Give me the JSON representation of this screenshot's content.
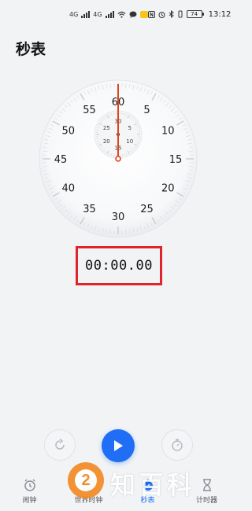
{
  "status_bar": {
    "carrier_left": "4G",
    "carrier_right": "4G",
    "battery": "74",
    "time": "13:12"
  },
  "page": {
    "title": "秒表"
  },
  "dial": {
    "major_labels": [
      "60",
      "5",
      "10",
      "15",
      "20",
      "25",
      "30",
      "35",
      "40",
      "45",
      "50",
      "55"
    ],
    "minor_labels": [
      "30",
      "5",
      "10",
      "15",
      "20",
      "25"
    ],
    "hand_color": "#e0461c",
    "hand_angle_deg": 0
  },
  "timer": {
    "value": "00:00.00",
    "highlight_color": "#e0242b"
  },
  "controls": {
    "reset_icon": "reset-icon",
    "play_icon": "play-icon",
    "lap_icon": "stopwatch-icon",
    "accent": "#1f6ef5"
  },
  "nav": {
    "items": [
      {
        "label": "闹钟",
        "icon": "alarm-clock-icon"
      },
      {
        "label": "世界时钟",
        "icon": "globe-icon"
      },
      {
        "label": "秒表",
        "icon": "stopwatch-icon"
      },
      {
        "label": "计时器",
        "icon": "hourglass-icon"
      }
    ],
    "active_index": 2
  },
  "watermark": {
    "badge": "2",
    "text": "知百科"
  }
}
